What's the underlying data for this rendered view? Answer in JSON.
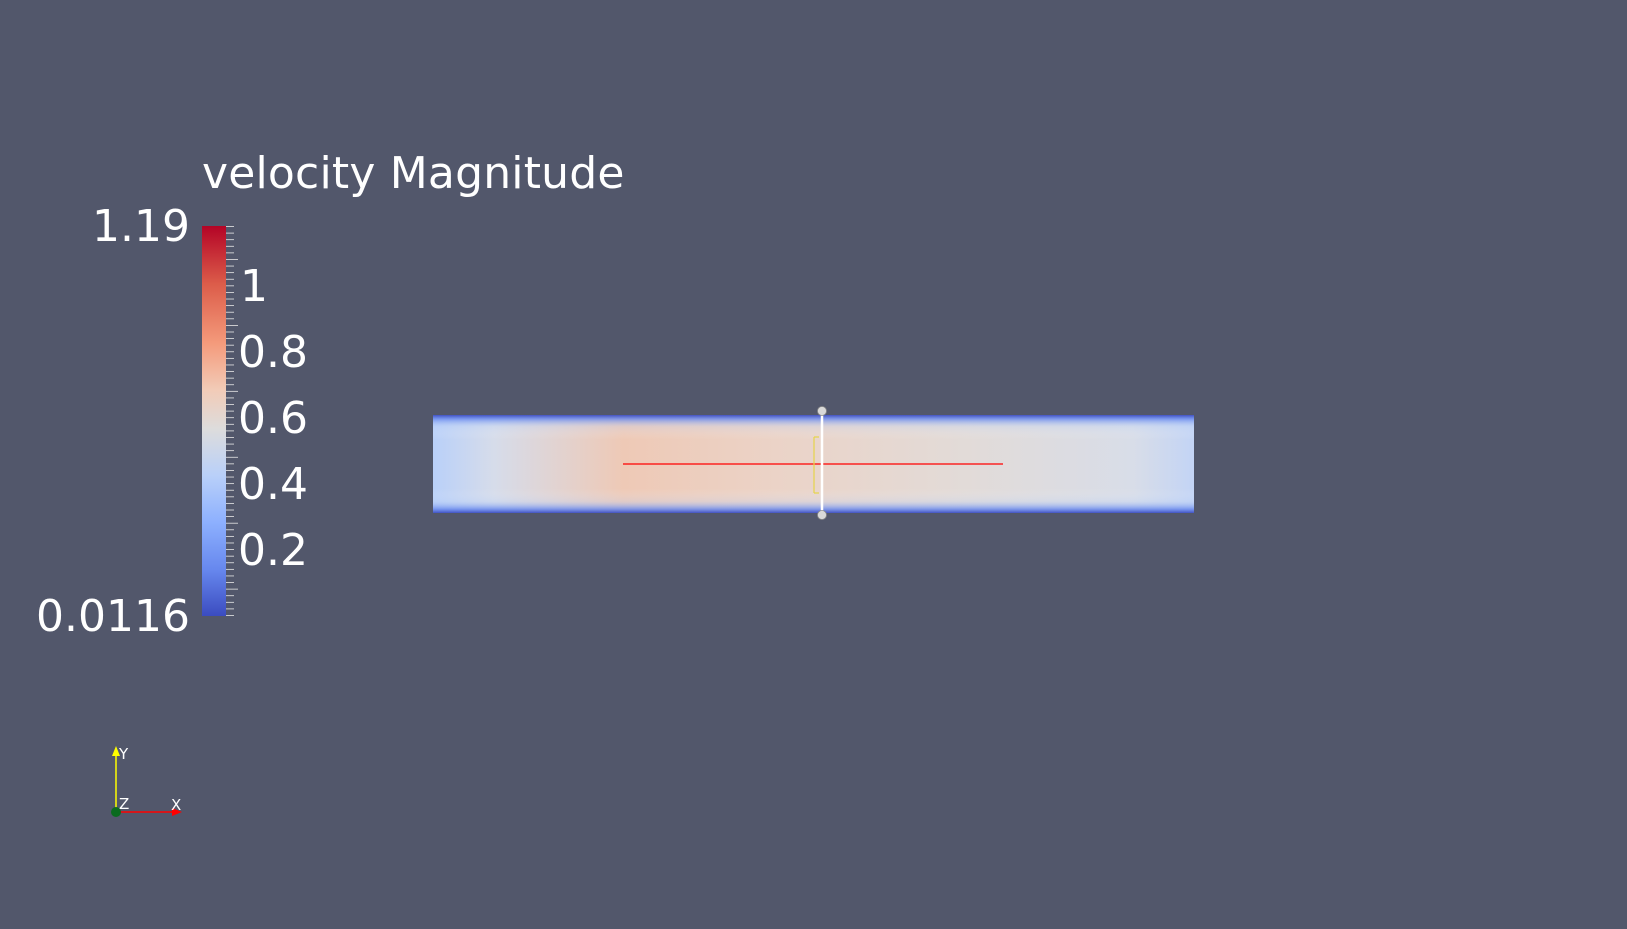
{
  "colorbar": {
    "title": "velocity Magnitude",
    "range_max": "1.19",
    "range_min": "0.0116",
    "ticks": [
      "1",
      "0.8",
      "0.6",
      "0.4",
      "0.2"
    ],
    "colormap": "Cool to Warm",
    "colors": {
      "high": "#b40426",
      "mid": "#dddcdc",
      "low": "#3b4cc0"
    }
  },
  "orientation_axes": {
    "x_label": "X",
    "y_label": "Y",
    "z_label": "Z",
    "x_color": "#ff0000",
    "y_color": "#ffff00",
    "z_color": "#006400"
  },
  "scene": {
    "background_color": "#52576b",
    "plot_over_line_widget": "red-line",
    "slice_widget": "white-line-with-handles"
  }
}
